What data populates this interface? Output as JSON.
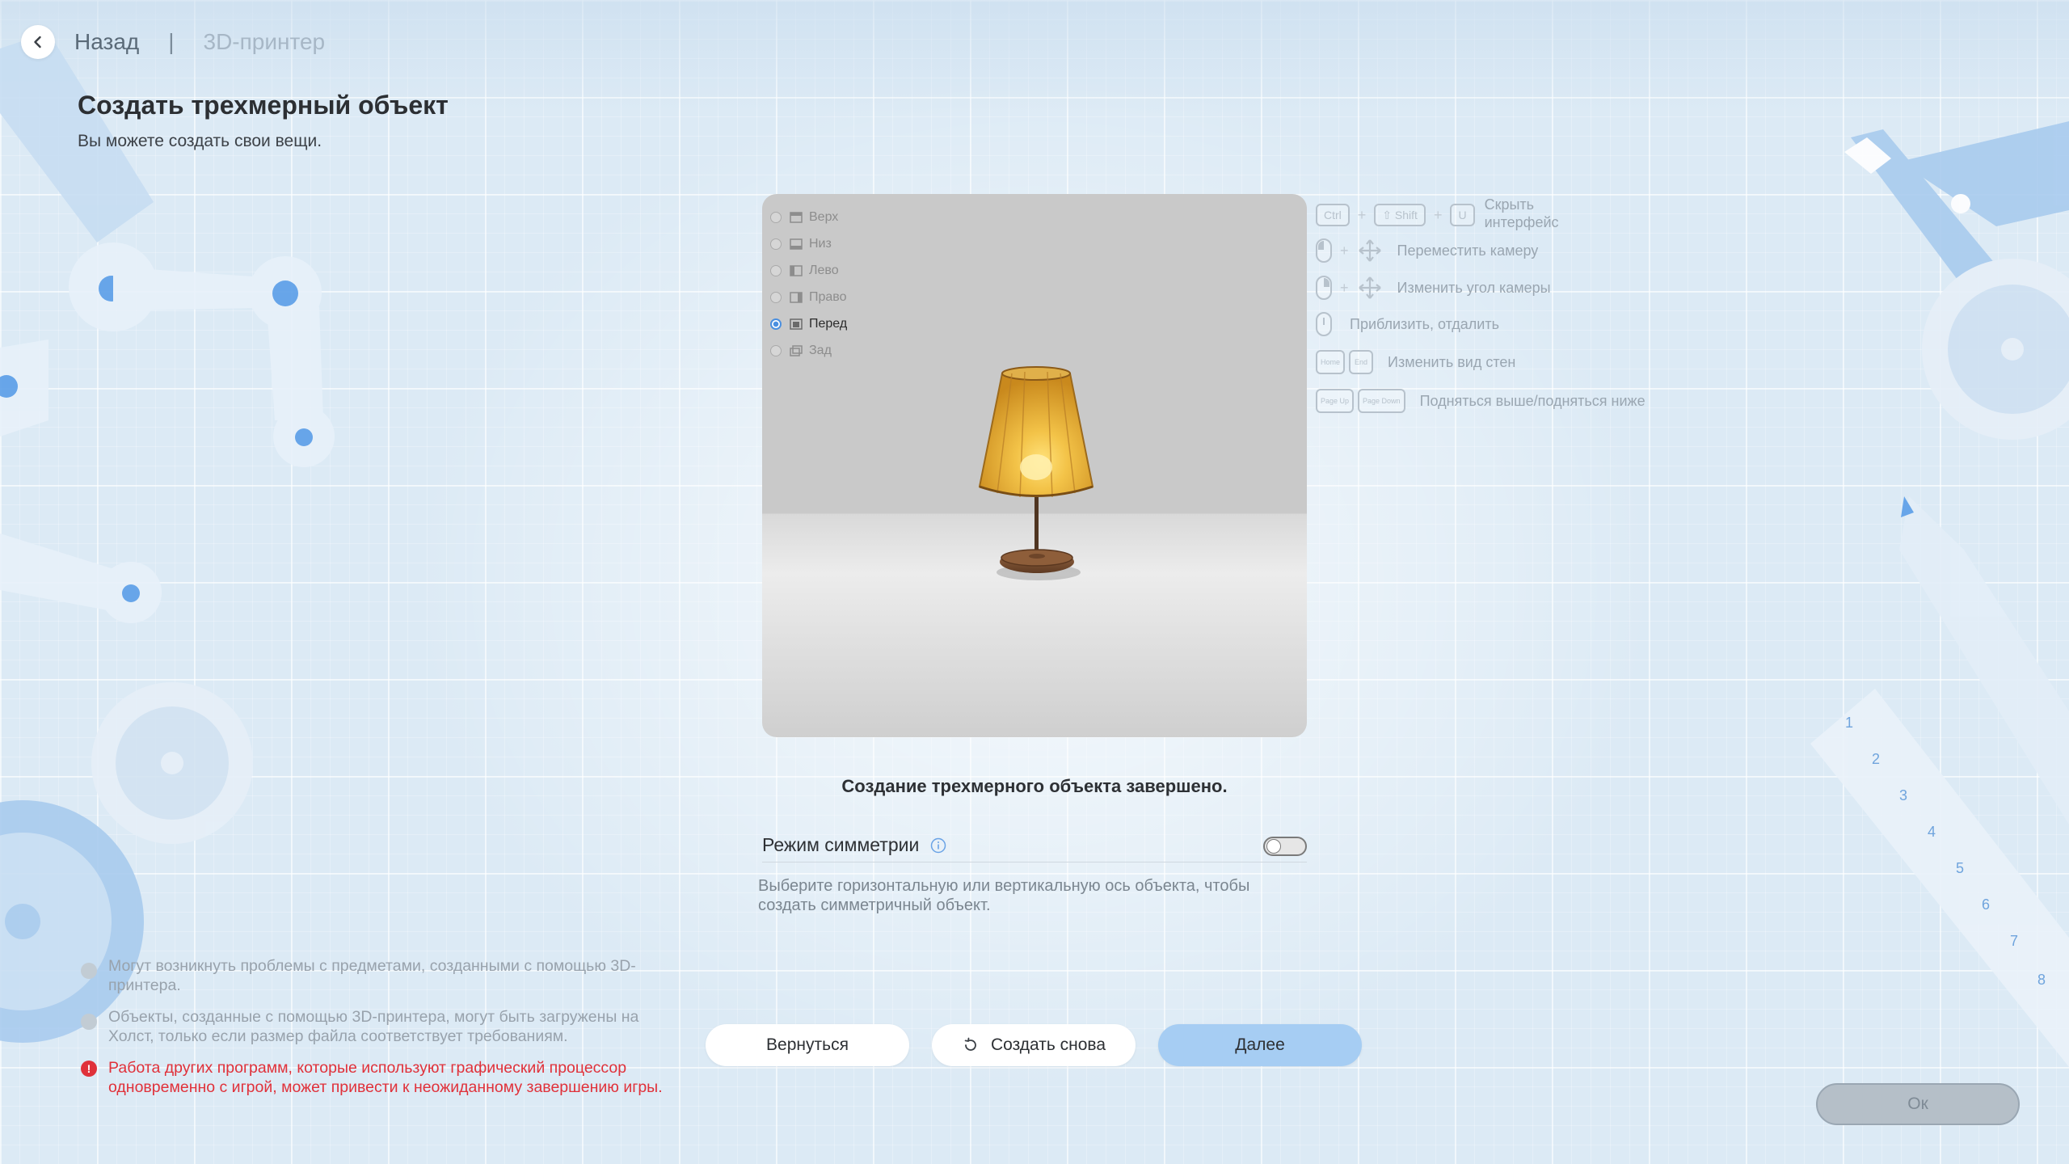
{
  "header": {
    "back_label": "Назад",
    "separator": "|",
    "breadcrumb": "3D-принтер"
  },
  "page": {
    "title": "Создать трехмерный объект",
    "subtitle": "Вы можете создать свои вещи."
  },
  "viewport": {
    "views": [
      {
        "label": "Верх",
        "selected": false
      },
      {
        "label": "Низ",
        "selected": false
      },
      {
        "label": "Лево",
        "selected": false
      },
      {
        "label": "Право",
        "selected": false
      },
      {
        "label": "Перед",
        "selected": true
      },
      {
        "label": "Зад",
        "selected": false
      }
    ]
  },
  "shortcuts": {
    "hide_ui": {
      "keys": [
        "Ctrl",
        "⇧ Shift",
        "U"
      ],
      "label": "Скрыть интерфейс"
    },
    "move_camera": {
      "label": "Переместить камеру"
    },
    "rotate_camera": {
      "label": "Изменить угол камеры"
    },
    "zoom": {
      "label": "Приблизить, отдалить"
    },
    "walls": {
      "keys": [
        "Home",
        "End"
      ],
      "label": "Изменить вид стен"
    },
    "height": {
      "keys": [
        "Page Up",
        "Page Down"
      ],
      "label": "Подняться выше/подняться ниже"
    }
  },
  "status": "Создание трехмерного объекта завершено.",
  "symmetry": {
    "label": "Режим симметрии",
    "enabled": false,
    "description": "Выберите горизонтальную или вертикальную ось объекта, чтобы создать симметричный объект."
  },
  "notices": [
    {
      "type": "info",
      "text": "Могут возникнуть проблемы с предметами, созданными с помощью 3D-принтера."
    },
    {
      "type": "info",
      "text": "Объекты, созданные с помощью 3D-принтера, могут быть загружены на Холст, только если размер файла соответствует требованиям."
    },
    {
      "type": "warning",
      "icon": "!",
      "text": "Работа других программ, которые используют графический процессор одновременно с игрой, может привести к неожиданному завершению игры."
    }
  ],
  "buttons": {
    "back": "Вернуться",
    "retry": "Создать снова",
    "next": "Далее",
    "ok": "Ок"
  },
  "colors": {
    "accent": "#a6cdf3",
    "warning": "#e0313a",
    "background": "#dceaf5"
  }
}
